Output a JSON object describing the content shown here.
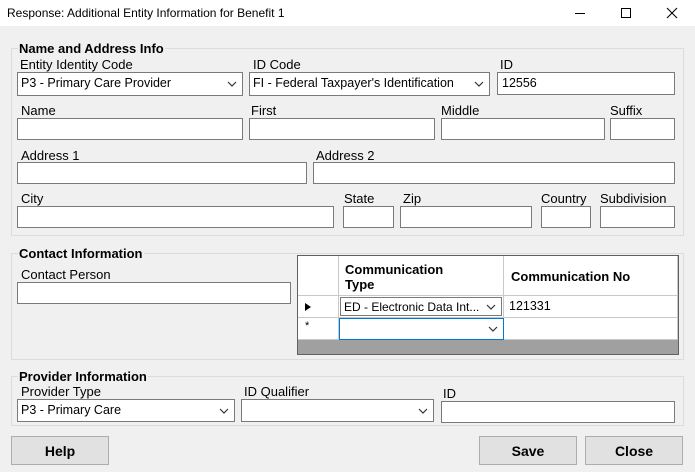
{
  "window": {
    "title": "Response: Additional  Entity Information for Benefit 1"
  },
  "name_address": {
    "title": "Name and Address Info",
    "entity_identity_code": {
      "label": "Entity Identity Code",
      "value": "P3 - Primary Care Provider"
    },
    "id_code": {
      "label": "ID Code",
      "value": "FI - Federal Taxpayer's Identification"
    },
    "id": {
      "label": "ID",
      "value": "12556"
    },
    "name": {
      "label": "Name",
      "value": ""
    },
    "first": {
      "label": "First",
      "value": ""
    },
    "middle": {
      "label": "Middle",
      "value": ""
    },
    "suffix": {
      "label": "Suffix",
      "value": ""
    },
    "address1": {
      "label": "Address 1",
      "value": ""
    },
    "address2": {
      "label": "Address 2",
      "value": ""
    },
    "city": {
      "label": "City",
      "value": ""
    },
    "state": {
      "label": "State",
      "value": ""
    },
    "zip": {
      "label": "Zip",
      "value": ""
    },
    "country": {
      "label": "Country",
      "value": ""
    },
    "subdivision": {
      "label": "Subdivision",
      "value": ""
    }
  },
  "contact": {
    "title": "Contact Information",
    "contact_person": {
      "label": "Contact Person",
      "value": ""
    },
    "grid": {
      "columns": [
        "Communication Type",
        "Communication No"
      ],
      "rows": [
        {
          "type": "ED - Electronic Data Int...",
          "number": "121331"
        },
        {
          "type": "",
          "number": ""
        }
      ]
    }
  },
  "provider": {
    "title": "Provider Information",
    "provider_type": {
      "label": "Provider Type",
      "value": "P3 - Primary Care"
    },
    "id_qualifier": {
      "label": "ID Qualifier",
      "value": ""
    },
    "id": {
      "label": "ID",
      "value": ""
    }
  },
  "buttons": {
    "help": "Help",
    "save": "Save",
    "close": "Close"
  }
}
